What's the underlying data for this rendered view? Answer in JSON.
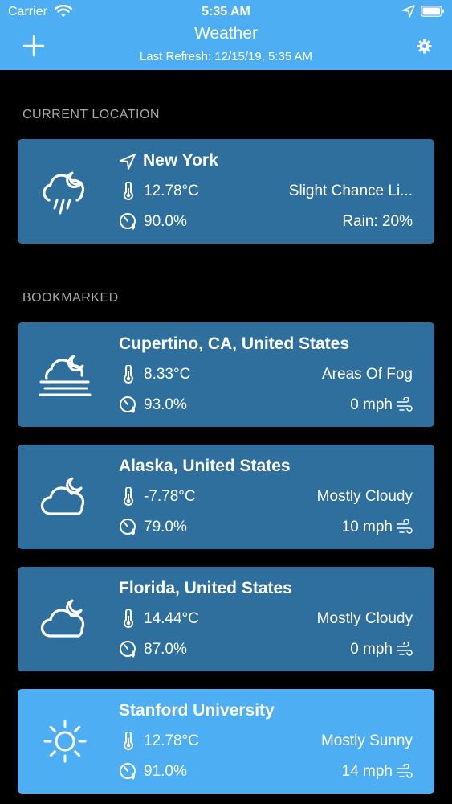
{
  "status_bar": {
    "carrier": "Carrier",
    "time": "5:35 AM"
  },
  "nav": {
    "title": "Weather",
    "last_refresh": "Last Refresh: 12/15/19, 5:35 AM",
    "add_icon": "plus-icon",
    "settings_icon": "gear-icon"
  },
  "sections": {
    "current": "CURRENT LOCATION",
    "bookmarked": "BOOKMARKED"
  },
  "colors": {
    "accent": "#4eaef4",
    "card": "#2f6f9e",
    "background": "#000000"
  },
  "current_location": {
    "name": "New York",
    "temperature": "12.78°C",
    "condition": "Slight Chance Li...",
    "humidity": "90.0%",
    "extra": "Rain: 20%",
    "icon": "cloud-rain-moon-icon"
  },
  "bookmarks": [
    {
      "name": "Cupertino, CA, United States",
      "temperature": "8.33°C",
      "condition": "Areas Of Fog",
      "humidity": "93.0%",
      "wind": "0 mph",
      "icon": "fog-moon-icon"
    },
    {
      "name": "Alaska, United States",
      "temperature": "-7.78°C",
      "condition": "Mostly Cloudy",
      "humidity": "79.0%",
      "wind": "10 mph",
      "icon": "cloud-moon-icon"
    },
    {
      "name": "Florida, United States",
      "temperature": "14.44°C",
      "condition": "Mostly Cloudy",
      "humidity": "87.0%",
      "wind": "0 mph",
      "icon": "cloud-moon-icon"
    },
    {
      "name": "Stanford University",
      "temperature": "12.78°C",
      "condition": "Mostly Sunny",
      "humidity": "91.0%",
      "wind": "14 mph",
      "icon": "sun-icon"
    }
  ]
}
